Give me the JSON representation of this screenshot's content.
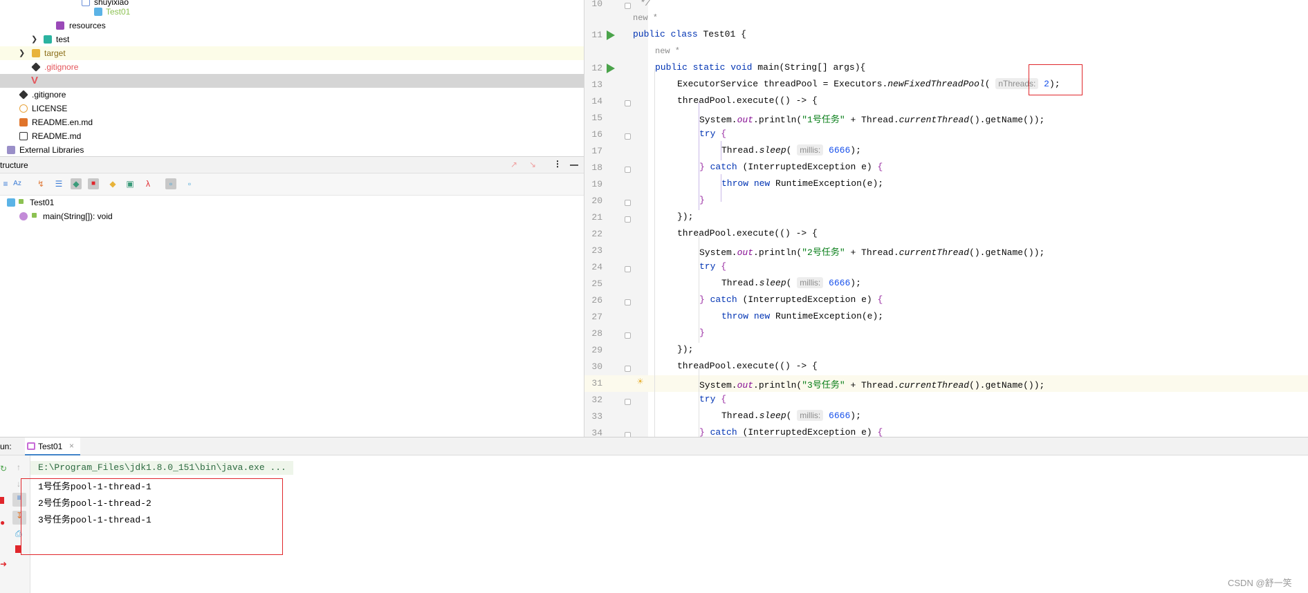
{
  "project_tree": {
    "items": [
      {
        "label": "shuyixiao",
        "color": "#000000"
      },
      {
        "label": "Test01",
        "color": "#8cc152"
      },
      {
        "label": "resources",
        "color": "#000000"
      },
      {
        "label": "test",
        "color": "#000000"
      },
      {
        "label": "target",
        "color": "#8a6d17"
      },
      {
        "label": ".gitignore",
        "color": "#e4555b"
      },
      {
        "label": "",
        "color": "#8cc152"
      },
      {
        "label": ".gitignore",
        "color": "#000000"
      },
      {
        "label": "LICENSE",
        "color": "#000000"
      },
      {
        "label": "README.en.md",
        "color": "#000000"
      },
      {
        "label": "README.md",
        "color": "#000000"
      },
      {
        "label": "External Libraries",
        "color": "#000000"
      }
    ]
  },
  "structure": {
    "title": "tructure",
    "class_name": "Test01",
    "method": "main(String[]): void"
  },
  "editor": {
    "meta_new_1": "new *",
    "meta_new_2": "new *",
    "line_numbers": [
      "10",
      "11",
      "12",
      "13",
      "14",
      "15",
      "16",
      "17",
      "18",
      "19",
      "20",
      "21",
      "22",
      "23",
      "24",
      "25",
      "26",
      "27",
      "28",
      "29",
      "30",
      "31",
      "32",
      "33",
      "34"
    ],
    "line10": "*/",
    "class_decl": {
      "kw1": "public",
      "kw2": "class",
      "name": "Test01",
      "brace": "{"
    },
    "main_decl": {
      "kw1": "public",
      "kw2": "static",
      "kw3": "void",
      "rest": "main(String[] args){"
    },
    "pool_decl": {
      "left": "ExecutorService threadPool = Executors.",
      "method": "newFixedThreadPool",
      "open": "(",
      "hint": "nThreads:",
      "arg": "2",
      "close": ");"
    },
    "execute": "threadPool.execute(() -> {",
    "println_prefix": "System.",
    "out": "out",
    "println_mid": ".println(",
    "task1": "\"1号任务\"",
    "task2": "\"2号任务\"",
    "task3": "\"3号任务\"",
    "plus_thread": " + Thread.",
    "current_thread": "currentThread",
    "get_name": "().getName",
    "get_name_end": "());",
    "kw_try": "try",
    "brace_open": "{",
    "thread_prefix": "Thread.",
    "sleep": "sleep",
    "sleep_hint": "millis:",
    "sleep_value": "6666",
    "sleep_close": ");",
    "catch_close_brace": "}",
    "kw_catch": "catch",
    "catch_args": "(InterruptedException e)",
    "kw_throw": "throw",
    "kw_new": "new",
    "throw_rest": "RuntimeException(e);",
    "close_brace": "}",
    "close_lambda": "});"
  },
  "run": {
    "tab_prefix": "un:",
    "tab_label": "Test01",
    "cmd": "E:\\Program_Files\\jdk1.8.0_151\\bin\\java.exe ...",
    "outputs": [
      "1号任务pool-1-thread-1",
      "2号任务pool-1-thread-2",
      "3号任务pool-1-thread-1"
    ]
  },
  "watermark": "CSDN @舒一笑",
  "colors": {
    "highlight_box": "#e0262b",
    "run_gutter_icon": "#4aa34a"
  }
}
